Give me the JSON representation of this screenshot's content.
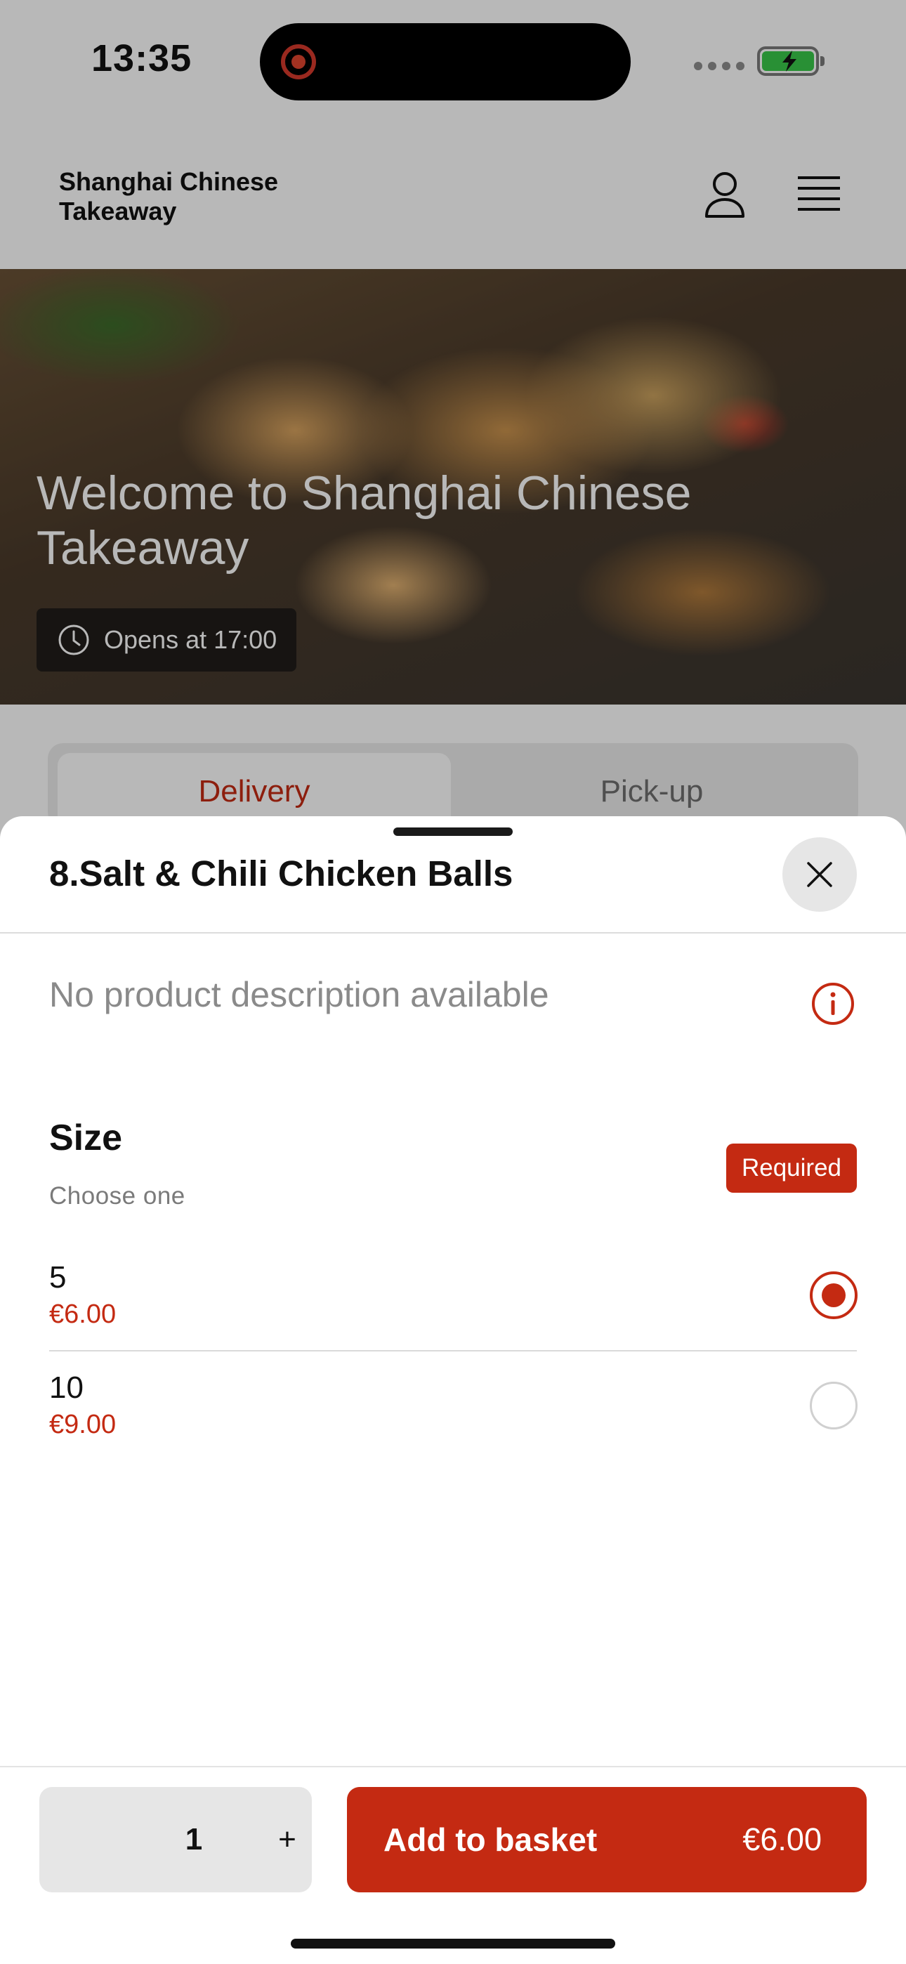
{
  "status_bar": {
    "time": "13:35"
  },
  "header": {
    "brand": "Shanghai Chinese Takeaway"
  },
  "hero": {
    "title": "Welcome to Shanghai Chinese Takeaway",
    "hours": "Opens at 17:00"
  },
  "mode_toggle": {
    "delivery": "Delivery",
    "pickup": "Pick-up"
  },
  "sheet": {
    "title": "8.Salt & Chili Chicken Balls",
    "description": "No product description available",
    "option_group": {
      "title": "Size",
      "subtitle": "Choose one",
      "badge": "Required",
      "options": [
        {
          "label": "5",
          "price": "€6.00",
          "selected": true
        },
        {
          "label": "10",
          "price": "€9.00",
          "selected": false
        }
      ]
    }
  },
  "footer": {
    "quantity": "1",
    "plus": "+",
    "add_label": "Add to basket",
    "add_price": "€6.00"
  },
  "colors": {
    "accent": "#c42a12",
    "battery": "#39c84a"
  },
  "icons": [
    "user-icon",
    "menu-icon",
    "clock-icon",
    "close-icon",
    "info-icon"
  ]
}
